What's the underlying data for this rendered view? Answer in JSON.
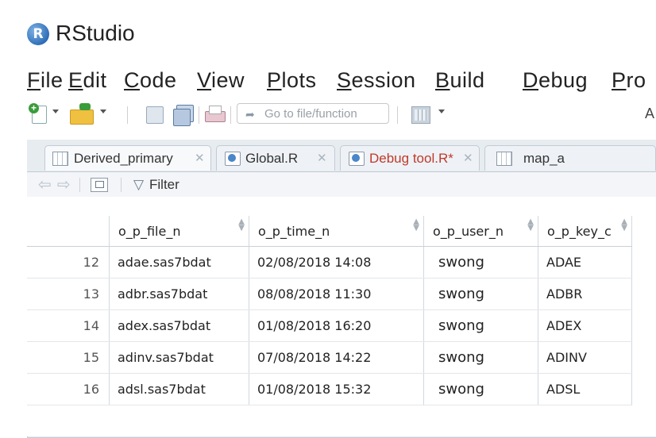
{
  "window": {
    "app_title": "RStudio",
    "logo_letter": "R"
  },
  "menu": [
    {
      "label": "File",
      "acc": "F",
      "rest": "ile"
    },
    {
      "label": "Edit",
      "acc": "E",
      "rest": "dit"
    },
    {
      "label": "Code",
      "acc": "C",
      "rest": "ode"
    },
    {
      "label": "View",
      "acc": "V",
      "rest": "iew"
    },
    {
      "label": "Plots",
      "acc": "P",
      "rest": "lots"
    },
    {
      "label": "Session",
      "acc": "S",
      "rest": "ession"
    },
    {
      "label": "Build",
      "acc": "B",
      "rest": "uild"
    },
    {
      "label": "Debug",
      "acc": "D",
      "rest": "ebug"
    },
    {
      "label": "Pro",
      "acc": "P",
      "rest": "ro"
    }
  ],
  "toolbar": {
    "goto_placeholder": "Go to file/function",
    "addins_label": "A"
  },
  "tabs": [
    {
      "label": "Derived_primary",
      "icon": "data-grid-icon",
      "modified": false
    },
    {
      "label": "Global.R",
      "icon": "r-script-icon",
      "modified": false
    },
    {
      "label": "Debug tool.R*",
      "icon": "r-script-icon",
      "modified": true
    },
    {
      "label": "map_a",
      "icon": "data-grid-icon",
      "modified": false
    }
  ],
  "viewer_toolbar": {
    "filter_label": "Filter"
  },
  "table": {
    "columns": [
      "o_p_file_n",
      "o_p_time_n",
      "o_p_user_n",
      "o_p_key_c"
    ],
    "rows": [
      {
        "n": "12",
        "file": "adae.sas7bdat",
        "time": "02/08/2018 14:08",
        "user": "swong",
        "key": "ADAE"
      },
      {
        "n": "13",
        "file": "adbr.sas7bdat",
        "time": "08/08/2018 11:30",
        "user": "swong",
        "key": "ADBR"
      },
      {
        "n": "14",
        "file": "adex.sas7bdat",
        "time": "01/08/2018 16:20",
        "user": "swong",
        "key": "ADEX"
      },
      {
        "n": "15",
        "file": "adinv.sas7bdat",
        "time": "07/08/2018 14:22",
        "user": "swong",
        "key": "ADINV"
      },
      {
        "n": "16",
        "file": "adsl.sas7bdat",
        "time": "01/08/2018 15:32",
        "user": "swong",
        "key": "ADSL"
      }
    ]
  }
}
